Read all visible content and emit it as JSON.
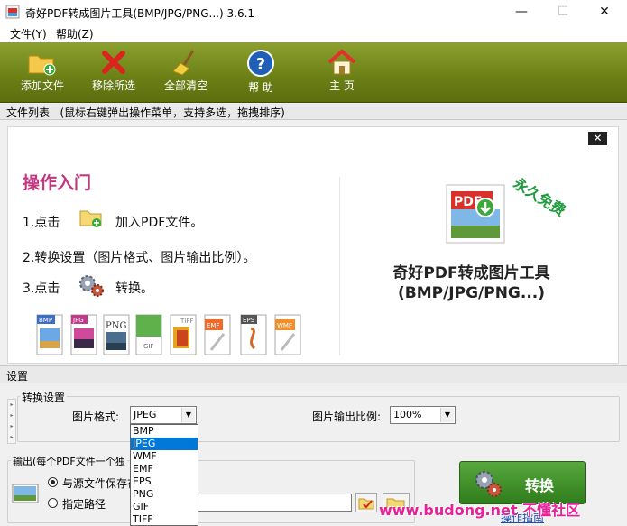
{
  "window": {
    "title": "奇好PDF转成图片工具(BMP/JPG/PNG...) 3.6.1",
    "minimize": "—",
    "maximize": "☐",
    "close": "✕"
  },
  "menu": {
    "file": "文件(Y)",
    "help": "帮助(Z)"
  },
  "toolbar": {
    "add_file": "添加文件",
    "remove_selected": "移除所选",
    "clear_all": "全部清空",
    "help": "帮 助",
    "home": "主 页"
  },
  "file_list": {
    "header": "文件列表",
    "hint": "(鼠标右键弹出操作菜单，支持多选，拖拽排序)",
    "close": "✕"
  },
  "guide": {
    "title": "操作入门",
    "step1_prefix": "1.点击",
    "step1_suffix": "加入PDF文件。",
    "step2": "2.转换设置（图片格式、图片输出比例）。",
    "step3_prefix": "3.点击",
    "step3_suffix": "转换。",
    "formats": [
      "BMP",
      "JPG",
      "PNG",
      "GIF",
      "TIFF",
      "EMF",
      "EPS",
      "WMF"
    ]
  },
  "promo": {
    "badge": "永久免费",
    "logo_text": "PDF",
    "name_line1": "奇好PDF转成图片工具",
    "name_line2": "(BMP/JPG/PNG...)"
  },
  "settings": {
    "header": "设置",
    "conversion_group": "转换设置",
    "format_label": "图片格式:",
    "format_value": "JPEG",
    "ratio_label": "图片输出比例:",
    "ratio_value": "100%",
    "format_options": [
      "BMP",
      "JPEG",
      "WMF",
      "EMF",
      "EPS",
      "PNG",
      "GIF",
      "TIFF"
    ],
    "output_group": "输出(每个PDF文件一个独",
    "radio_same_dir": "与源文件保存在",
    "radio_custom": "指定路径",
    "convert_button": "转换",
    "help_link": "操作指南"
  },
  "watermark": "www.budong.net 不懂社区",
  "colors": {
    "toolbar": "#6b7f16",
    "guide_title": "#c2377f",
    "badge": "#1e9b3b",
    "selection": "#0078d7",
    "convert": "#3f9128",
    "watermark": "#e8209a"
  }
}
